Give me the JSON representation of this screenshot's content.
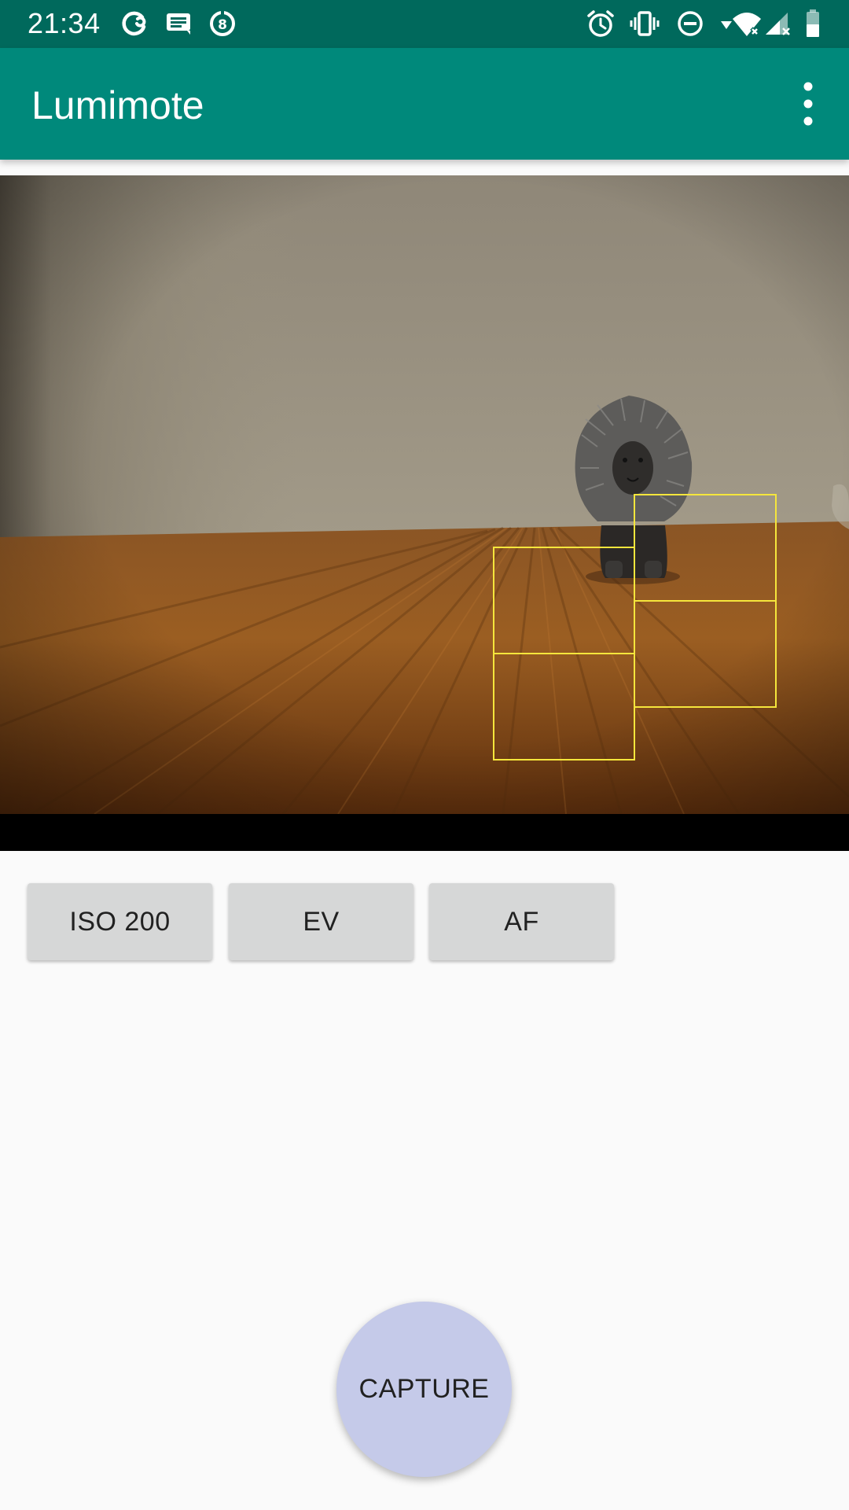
{
  "status_bar": {
    "time": "21:34",
    "left_icons": [
      "sync-icon",
      "message-icon",
      "data-saver-icon"
    ],
    "right_icons": [
      "alarm-icon",
      "vibrate-icon",
      "do-not-disturb-icon",
      "wifi-icon",
      "signal-icon",
      "battery-icon"
    ]
  },
  "app_bar": {
    "title": "Lumimote",
    "menu_icon": "more-vert-icon"
  },
  "settings": {
    "iso_label": "ISO 200",
    "ev_label": "EV",
    "af_label": "AF"
  },
  "capture": {
    "label": "CAPTURE"
  },
  "colors": {
    "status_bar": "#00695c",
    "app_bar": "#00897b",
    "capture_button": "#c5cae9",
    "setting_button": "#d6d7d7",
    "af_frame": "#f5e63c"
  }
}
